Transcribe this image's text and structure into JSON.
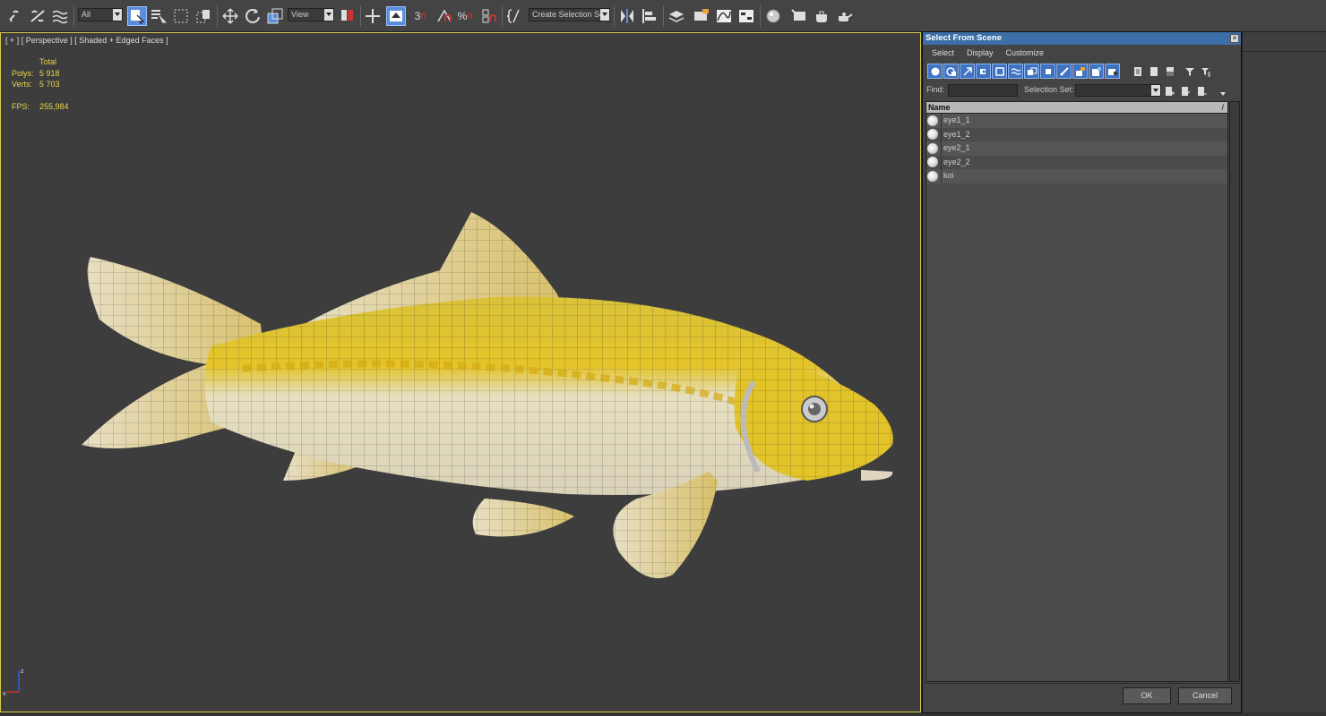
{
  "toolbar": {
    "selection_filter": "All",
    "reference_coord": "View",
    "named_selection": "Create Selection Se",
    "snap_angle_label": "3",
    "percent_label": "%"
  },
  "viewport": {
    "label": "[ + ] [ Perspective ] [ Shaded + Edged Faces ]",
    "stats": {
      "total_label": "Total",
      "polys_label": "Polys:",
      "polys_value": "5 918",
      "verts_label": "Verts:",
      "verts_value": "5 703",
      "fps_label": "FPS:",
      "fps_value": "255,984"
    },
    "axis_z": "z",
    "axis_x": "x"
  },
  "dialog": {
    "title": "Select From Scene",
    "close": "×",
    "menu": [
      "Select",
      "Display",
      "Customize"
    ],
    "find_label": "Find:",
    "find_value": "",
    "selection_set_label": "Selection Set:",
    "selection_set_value": "",
    "column_name": "Name",
    "sort_indicator": "/",
    "items": [
      "eye1_1",
      "eye1_2",
      "eye2_1",
      "eye2_2",
      "koi"
    ],
    "ok": "OK",
    "cancel": "Cancel"
  },
  "colors": {
    "accent": "#3c6ea8",
    "active_tool": "#5b8dd9",
    "stats_text": "#e8d44d",
    "viewport_bg": "#3d3d3d"
  }
}
